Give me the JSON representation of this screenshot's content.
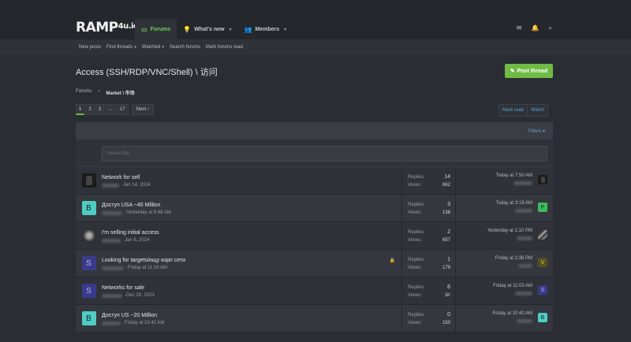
{
  "header": {
    "logo_main": "RAMP",
    "logo_small": "4u.io",
    "nav": [
      {
        "label": "Forums",
        "icon": "forum-icon",
        "glyph": "▭",
        "active": true,
        "caret": false
      },
      {
        "label": "What's new",
        "icon": "bulb-icon",
        "glyph": "💡",
        "active": false,
        "caret": true
      },
      {
        "label": "Members",
        "icon": "members-icon",
        "glyph": "👥",
        "active": false,
        "caret": true
      }
    ],
    "caret": "▾",
    "icons": {
      "inbox": "✉",
      "alerts": "🔔",
      "search": "⌕"
    }
  },
  "subnav": [
    "New posts",
    "Find threads",
    "Watched",
    "Search forums",
    "Mark forums read"
  ],
  "page": {
    "title": "Access (SSH/RDP/VNC/Shell) \\ 访问",
    "post_button": "Post thread",
    "post_icon": "✎"
  },
  "breadcrumbs": {
    "root": "Forums",
    "sep": "›",
    "current": "Market \\ 市场"
  },
  "pager": {
    "pages": [
      "1",
      "2",
      "3",
      "…",
      "17"
    ],
    "next": "Next ›"
  },
  "actions": {
    "mark_read": "Mark read",
    "watch": "Watch"
  },
  "filters": "Filters ▾",
  "new_thread_placeholder": "Thread title",
  "stat_labels": {
    "replies": "Replies:",
    "views": "Views:"
  },
  "colors": {
    "accent_green": "#6fbb45",
    "link_blue": "#5aa3d8",
    "teal": "#4ecdc4",
    "indigo": "#3a3a8c",
    "green": "#3cbc5c",
    "olive": "#555020"
  },
  "threads": [
    {
      "title": "Network for sell",
      "date": "Jan 14, 2024",
      "replies": "14",
      "views": "662",
      "last": "Today at 7:50 AM",
      "avatar": "dark",
      "letter": "",
      "mini": "dark",
      "mini_letter": "",
      "locked": false
    },
    {
      "title": "Доступ USA ~40 Million",
      "date": "Yesterday at 5:48 AM",
      "replies": "3",
      "views": "138",
      "last": "Today at 3:19 AM",
      "avatar": "teal",
      "letter": "B",
      "mini": "green",
      "mini_letter": "P",
      "locked": false
    },
    {
      "title": "I'm selling initial access",
      "date": "Jan 6, 2024",
      "replies": "2",
      "views": "657",
      "last": "Yesterday at 1:10 PM",
      "avatar": "photo",
      "letter": "",
      "mini": "photo2",
      "mini_letter": "",
      "locked": false
    },
    {
      "title": "Looking for targets/ищу корп сети",
      "date": "Friday at 11:16 AM",
      "replies": "1",
      "views": "179",
      "last": "Friday at 2:38 PM",
      "avatar": "indigo",
      "letter": "S",
      "mini": "olive",
      "mini_letter": "V",
      "locked": true
    },
    {
      "title": "Networks for sale",
      "date": "Dec 29, 2023",
      "replies": "6",
      "views": "1K",
      "last": "Friday at 11:03 AM",
      "avatar": "indigo",
      "letter": "S",
      "mini": "indigo",
      "mini_letter": "S",
      "locked": false
    },
    {
      "title": "Доступ US ~20 Million",
      "date": "Friday at 10:42 AM",
      "replies": "0",
      "views": "150",
      "last": "Friday at 10:42 AM",
      "avatar": "teal",
      "letter": "B",
      "mini": "teal",
      "mini_letter": "B",
      "locked": false
    }
  ]
}
